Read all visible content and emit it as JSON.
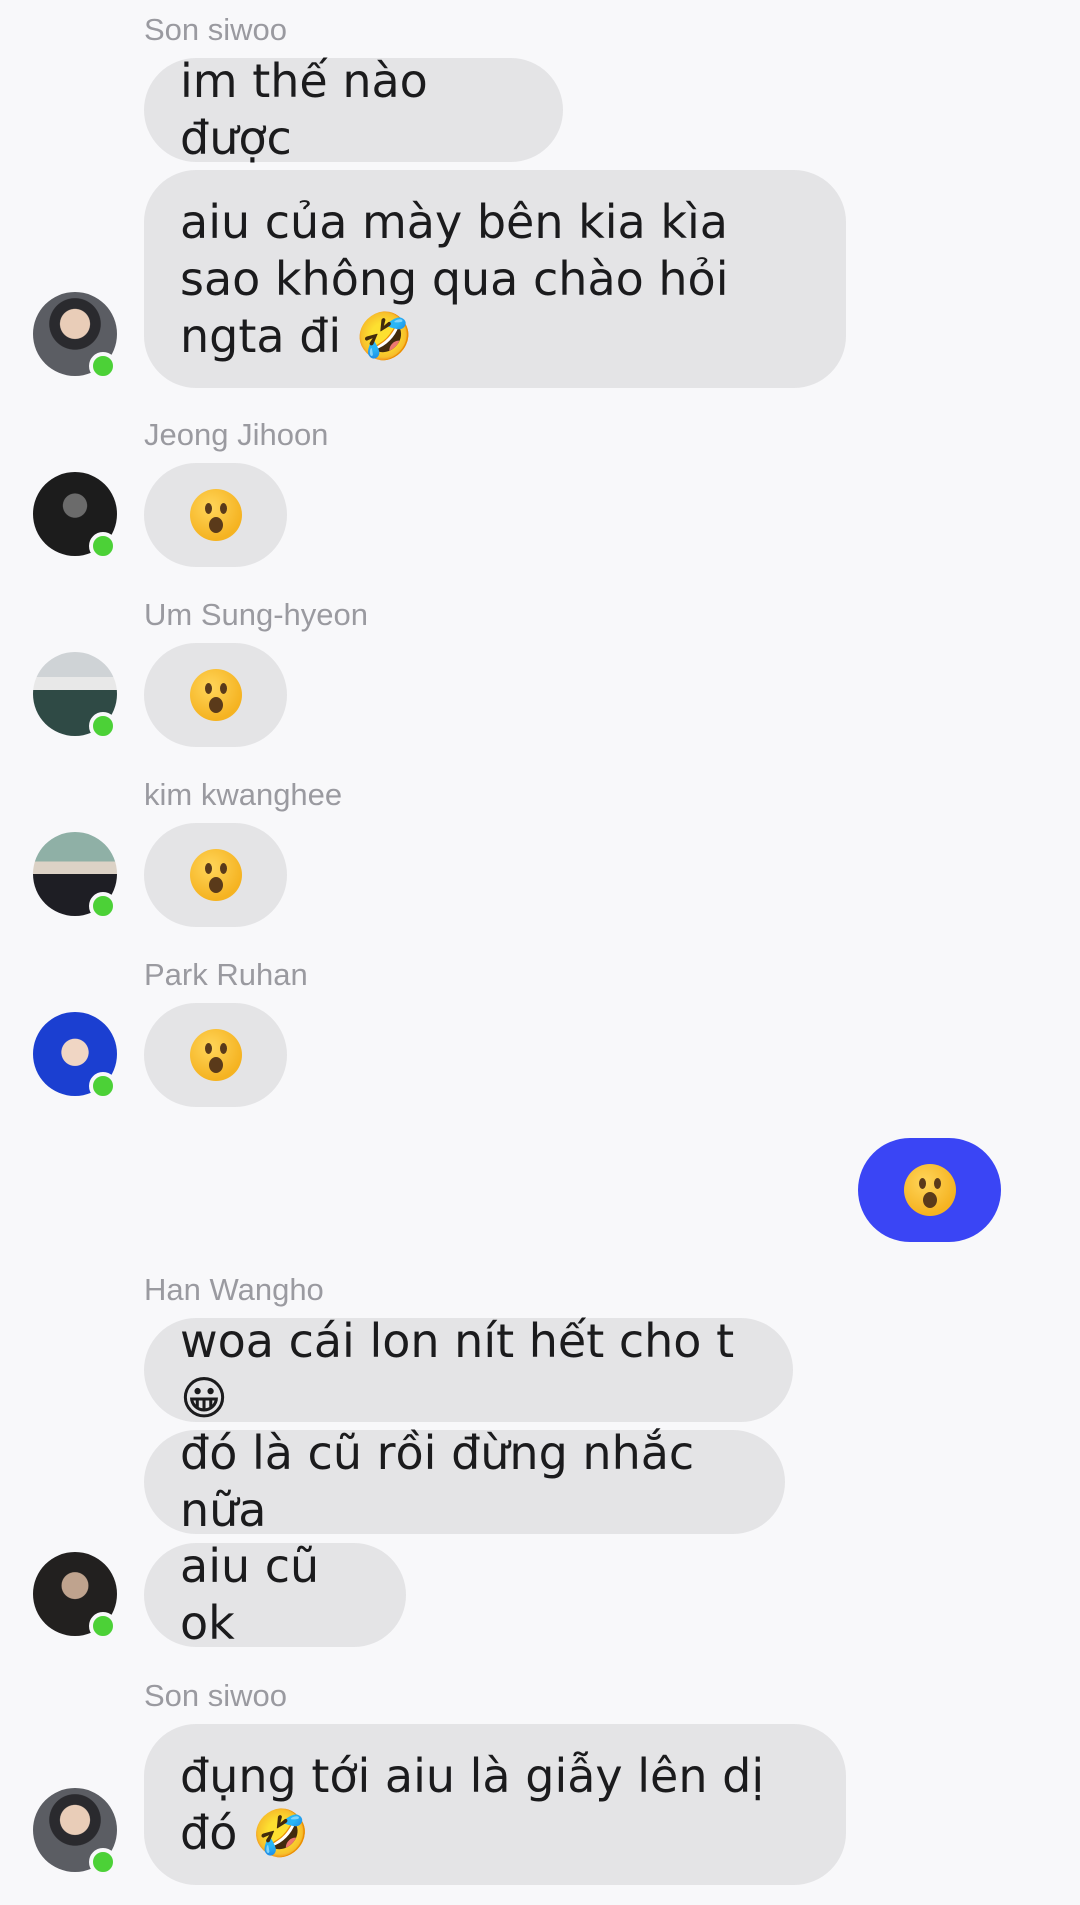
{
  "messages": {
    "m1": {
      "sender": "Son siwoo",
      "text": "im thế nào được"
    },
    "m2": {
      "text": "aiu của mày bên kia kìa sao không qua chào hỏi ngta đi 🤣"
    },
    "m3": {
      "sender": "Jeong Jihoon",
      "emoji": "😮"
    },
    "m4": {
      "sender": "Um Sung-hyeon",
      "emoji": "😮"
    },
    "m5": {
      "sender": "kim kwanghee",
      "emoji": "😮"
    },
    "m6": {
      "sender": "Park Ruhan",
      "emoji": "😮"
    },
    "m7": {
      "emoji": "😮"
    },
    "m8": {
      "sender": "Han Wangho",
      "text": "woa cái lon nít hết cho t 😀"
    },
    "m9": {
      "text": "đó là cũ rồi đừng nhắc nữa"
    },
    "m10": {
      "text": "aiu cũ ok"
    },
    "m11": {
      "sender": "Son siwoo",
      "text": "đụng tới aiu là giẫy lên dị đó 🤣"
    }
  },
  "colors": {
    "incoming_bubble": "#e4e4e6",
    "outgoing_bubble": "#3a45f5",
    "online_dot": "#4cd137",
    "sender_text": "#9a9aa0"
  },
  "icons": {
    "online": "online-status-dot",
    "reaction": "face-with-open-mouth-emoji"
  }
}
